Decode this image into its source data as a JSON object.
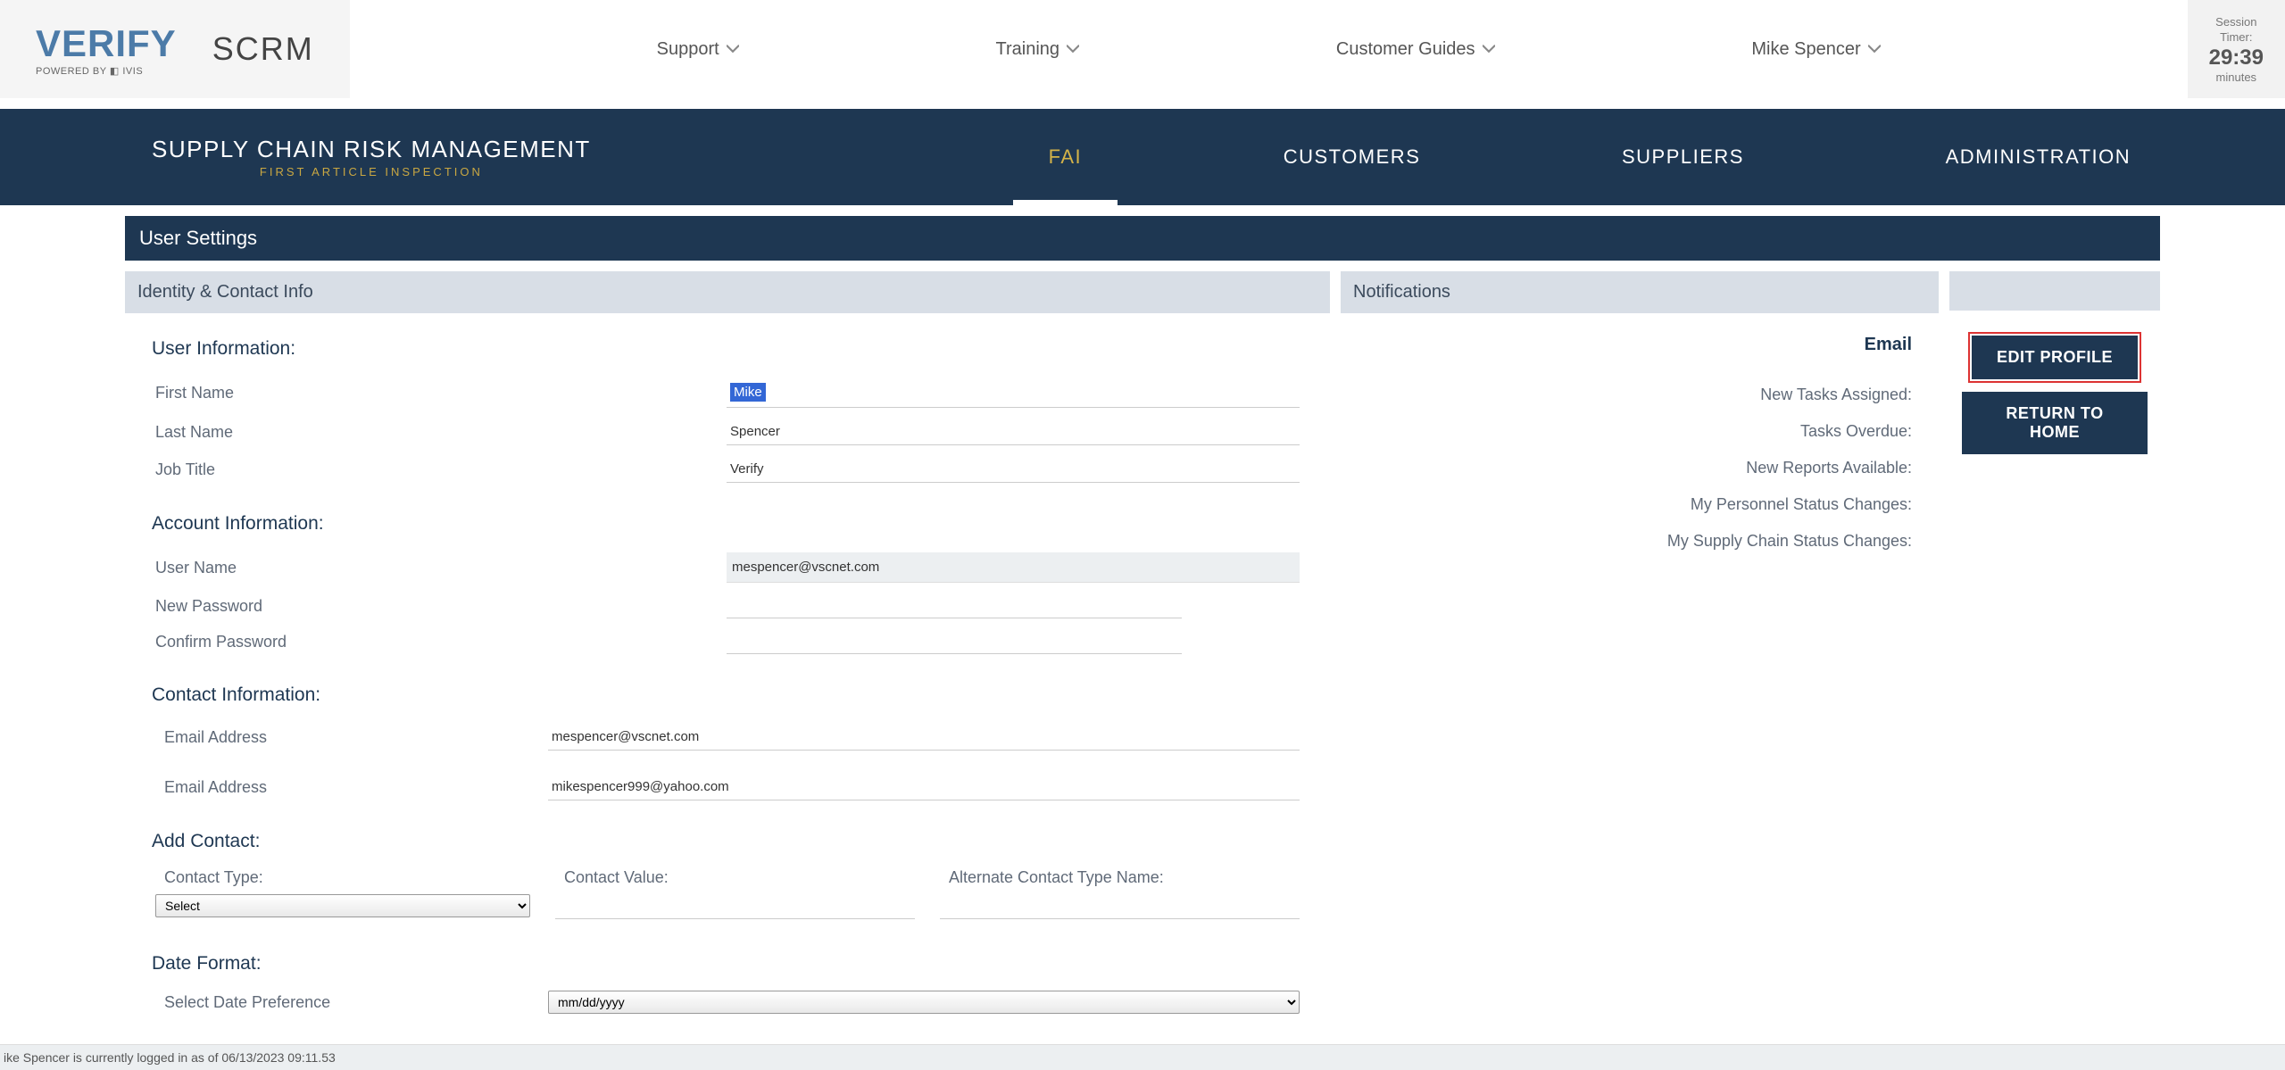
{
  "header": {
    "logo_main": "VERIFY",
    "logo_sub": "POWERED BY ◧ IVIS",
    "scrm": "SCRM",
    "nav": {
      "support": "Support",
      "training": "Training",
      "customer_guides": "Customer Guides",
      "user": "Mike Spencer"
    },
    "session": {
      "label1": "Session",
      "label2": "Timer:",
      "time": "29:39",
      "minutes": "minutes"
    }
  },
  "bluenav": {
    "title": "SUPPLY CHAIN RISK MANAGEMENT",
    "subtitle": "FIRST ARTICLE INSPECTION",
    "items": {
      "fai": "FAI",
      "customers": "CUSTOMERS",
      "suppliers": "SUPPLIERS",
      "administration": "ADMINISTRATION"
    }
  },
  "page": {
    "title": "User Settings",
    "identity_header": "Identity & Contact Info",
    "notifications_header": "Notifications"
  },
  "user_info": {
    "heading": "User Information:",
    "first_name_label": "First Name",
    "first_name_value": "Mike",
    "last_name_label": "Last Name",
    "last_name_value": "Spencer",
    "job_title_label": "Job Title",
    "job_title_value": "Verify"
  },
  "account_info": {
    "heading": "Account Information:",
    "username_label": "User Name",
    "username_value": "mespencer@vscnet.com",
    "newpass_label": "New Password",
    "confirmpass_label": "Confirm Password"
  },
  "contact_info": {
    "heading": "Contact Information:",
    "email1_label": "Email Address",
    "email1_value": "mespencer@vscnet.com",
    "email2_label": "Email Address",
    "email2_value": "mikespencer999@yahoo.com"
  },
  "add_contact": {
    "heading": "Add Contact:",
    "type_label": "Contact Type:",
    "type_select": "Select",
    "value_label": "Contact Value:",
    "alt_label": "Alternate Contact Type Name:"
  },
  "date_format": {
    "heading": "Date Format:",
    "pref_label": "Select Date Preference",
    "pref_value": "mm/dd/yyyy"
  },
  "notifications": {
    "email_col": "Email",
    "rows": {
      "new_tasks": "New Tasks Assigned:",
      "overdue": "Tasks Overdue:",
      "reports": "New Reports Available:",
      "personnel": "My Personnel Status Changes:",
      "supply": "My Supply Chain Status Changes:"
    }
  },
  "actions": {
    "edit": "EDIT PROFILE",
    "home": "RETURN TO HOME"
  },
  "footer": {
    "status": "ike Spencer is currently logged in as of 06/13/2023 09:11.53"
  }
}
